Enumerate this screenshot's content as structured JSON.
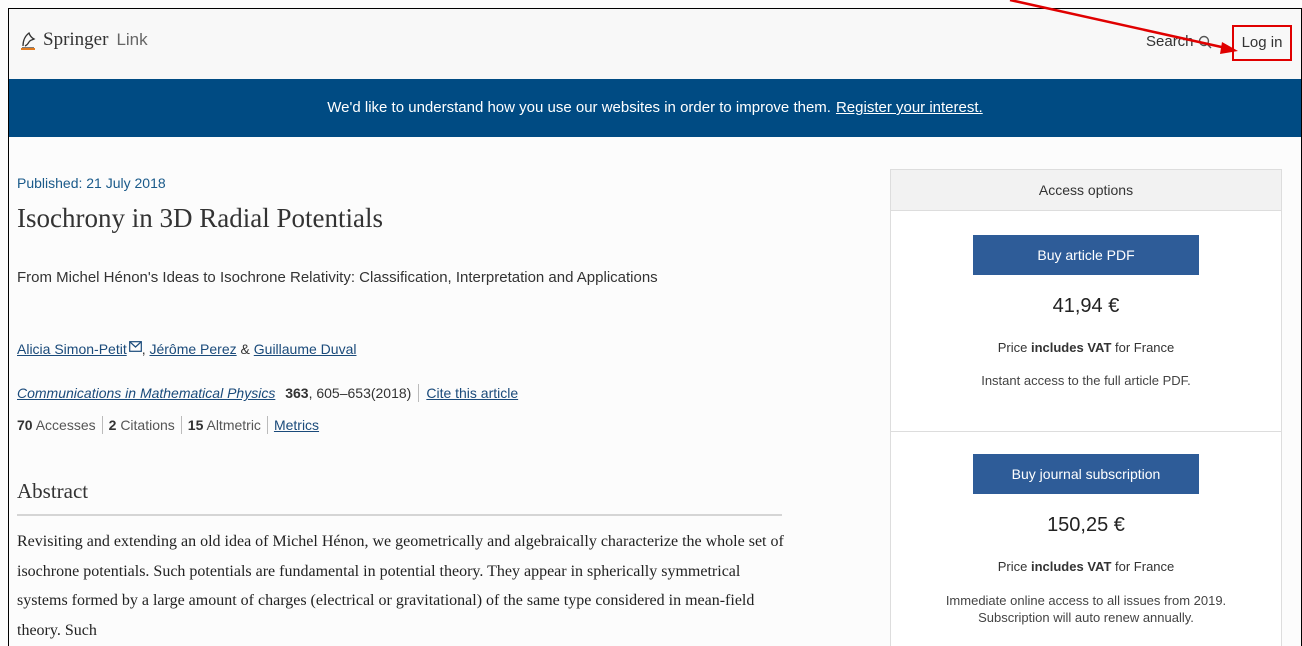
{
  "header": {
    "logo_springer": "Springer",
    "logo_link": "Link",
    "search_label": "Search",
    "login_label": "Log in"
  },
  "banner": {
    "text": "We'd like to understand how you use our websites in order to improve them.",
    "link": "Register your interest."
  },
  "article": {
    "published": "Published: 21 July 2018",
    "title": "Isochrony in 3D Radial Potentials",
    "subtitle": "From Michel Hénon's Ideas to Isochrone Relativity: Classification, Interpretation and Applications",
    "authors": [
      "Alicia Simon-Petit",
      "Jérôme Perez",
      "Guillaume Duval"
    ],
    "author_sep1": ",",
    "author_sep2": "&",
    "journal": "Communications in Mathematical Physics",
    "volume": "363",
    "pages": ", 605–653(2018)",
    "cite": "Cite this article",
    "accesses_num": "70",
    "accesses_label": "Accesses",
    "citations_num": "2",
    "citations_label": "Citations",
    "altmetric_num": "15",
    "altmetric_label": "Altmetric",
    "metrics_link": "Metrics",
    "abstract_heading": "Abstract",
    "abstract_text": "Revisiting and extending an old idea of Michel Hénon, we geometrically and algebraically characterize the whole set of isochrone potentials. Such potentials are fundamental in potential theory. They appear in spherically symmetrical systems formed by a large amount of charges (electrical or gravitational) of the same type considered in mean-field theory. Such"
  },
  "access": {
    "heading": "Access options",
    "pdf_button": "Buy article PDF",
    "pdf_price": "41,94 €",
    "vat_prefix": "Price",
    "vat_bold": "includes VAT",
    "vat_suffix": "for France",
    "pdf_note": "Instant access to the full article PDF.",
    "sub_button": "Buy journal subscription",
    "sub_price": "150,25 €",
    "sub_note_1": "Immediate online access to all issues from 2019.",
    "sub_note_2": "Subscription will auto renew annually."
  },
  "colors": {
    "banner_bg": "#004b83",
    "button_bg": "#2e5c98",
    "highlight": "#e00000"
  }
}
